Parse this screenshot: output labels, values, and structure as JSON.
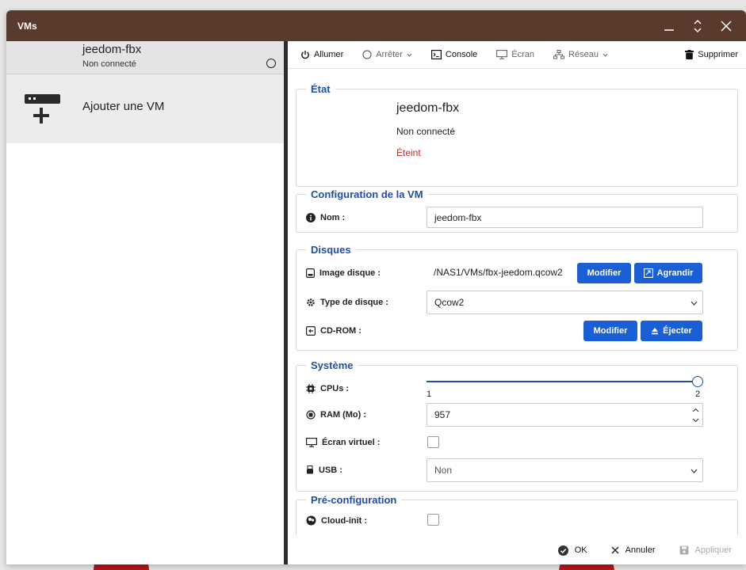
{
  "window": {
    "title": "VMs"
  },
  "vm_list": {
    "items": [
      {
        "name": "jeedom-fbx",
        "status": "Non connecté"
      }
    ],
    "add_label": "Ajouter une VM"
  },
  "toolbar": {
    "power_on": "Allumer",
    "stop": "Arrêter",
    "console": "Console",
    "screen": "Écran",
    "network": "Réseau",
    "delete": "Supprimer"
  },
  "state": {
    "legend": "État",
    "vm_name": "jeedom-fbx",
    "connection": "Non connecté",
    "power": "Éteint",
    "power_color": "#c62828"
  },
  "config": {
    "legend": "Configuration de la VM",
    "name_label": "Nom :",
    "name_value": "jeedom-fbx"
  },
  "disks": {
    "legend": "Disques",
    "image_label": "Image disque :",
    "image_path": "/NAS1/VMs/fbx-jeedom.qcow2",
    "modify": "Modifier",
    "grow": "Agrandir",
    "type_label": "Type de disque :",
    "type_value": "Qcow2",
    "cdrom_label": "CD-ROM :",
    "cdrom_modify": "Modifier",
    "eject": "Éjecter"
  },
  "system": {
    "legend": "Système",
    "cpus_label": "CPUs :",
    "cpus_min": "1",
    "cpus_max": "2",
    "cpus_value": 2,
    "ram_label": "RAM (Mo) :",
    "ram_value": "957",
    "screen_label": "Écran virtuel :",
    "screen_checked": false,
    "usb_label": "USB :",
    "usb_value": "Non"
  },
  "preconfig": {
    "legend": "Pré-configuration",
    "cloudinit_label": "Cloud-init :",
    "cloudinit_checked": false
  },
  "help_glyph": "?",
  "footer": {
    "ok": "OK",
    "cancel": "Annuler",
    "apply": "Appliquer"
  },
  "colors": {
    "titlebar": "#5b3a2e",
    "accent": "#1a5fd6",
    "legend": "#1d4fa8"
  }
}
